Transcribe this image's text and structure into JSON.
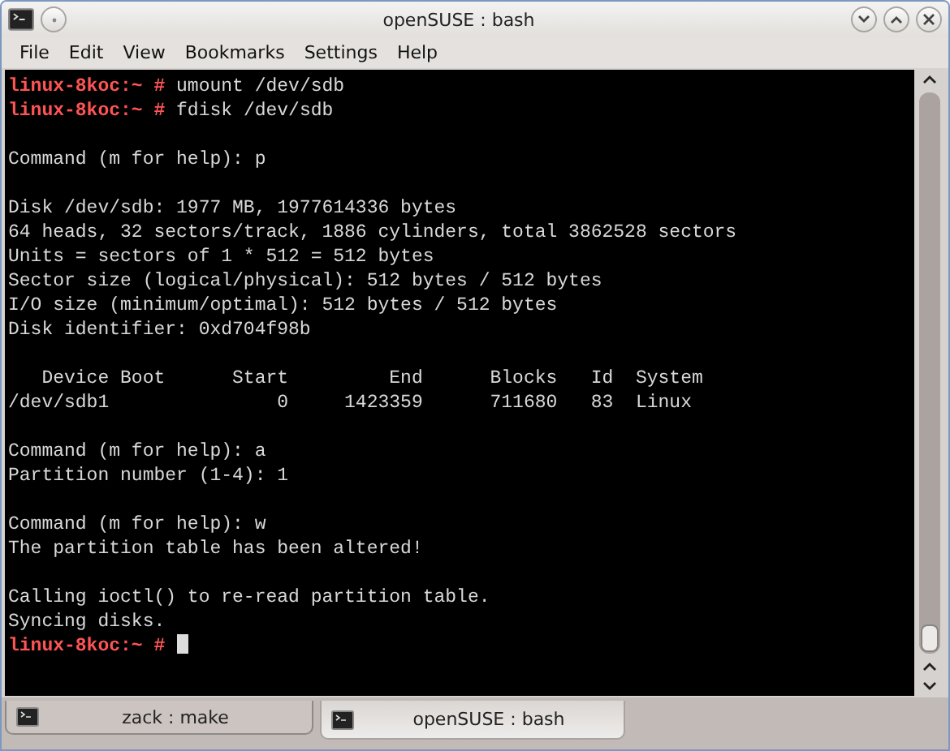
{
  "window": {
    "title": "openSUSE : bash"
  },
  "menu": [
    "File",
    "Edit",
    "View",
    "Bookmarks",
    "Settings",
    "Help"
  ],
  "terminal": {
    "lines": [
      {
        "kind": "prompt",
        "prompt": "linux-8koc:~ #",
        "command": "umount /dev/sdb"
      },
      {
        "kind": "prompt",
        "prompt": "linux-8koc:~ #",
        "command": "fdisk /dev/sdb"
      },
      {
        "kind": "blank"
      },
      {
        "kind": "output",
        "text": "Command (m for help): p"
      },
      {
        "kind": "blank"
      },
      {
        "kind": "output",
        "text": "Disk /dev/sdb: 1977 MB, 1977614336 bytes"
      },
      {
        "kind": "output",
        "text": "64 heads, 32 sectors/track, 1886 cylinders, total 3862528 sectors"
      },
      {
        "kind": "output",
        "text": "Units = sectors of 1 * 512 = 512 bytes"
      },
      {
        "kind": "output",
        "text": "Sector size (logical/physical): 512 bytes / 512 bytes"
      },
      {
        "kind": "output",
        "text": "I/O size (minimum/optimal): 512 bytes / 512 bytes"
      },
      {
        "kind": "output",
        "text": "Disk identifier: 0xd704f98b"
      },
      {
        "kind": "blank"
      },
      {
        "kind": "output",
        "text": "   Device Boot      Start         End      Blocks   Id  System"
      },
      {
        "kind": "output",
        "text": "/dev/sdb1               0     1423359      711680   83  Linux"
      },
      {
        "kind": "blank"
      },
      {
        "kind": "output",
        "text": "Command (m for help): a"
      },
      {
        "kind": "output",
        "text": "Partition number (1-4): 1"
      },
      {
        "kind": "blank"
      },
      {
        "kind": "output",
        "text": "Command (m for help): w"
      },
      {
        "kind": "output",
        "text": "The partition table has been altered!"
      },
      {
        "kind": "blank"
      },
      {
        "kind": "output",
        "text": "Calling ioctl() to re-read partition table."
      },
      {
        "kind": "output",
        "text": "Syncing disks."
      },
      {
        "kind": "input",
        "prompt": "linux-8koc:~ #"
      }
    ]
  },
  "tabs": [
    {
      "label": "zack : make",
      "selected": false
    },
    {
      "label": "openSUSE : bash",
      "selected": true
    }
  ]
}
